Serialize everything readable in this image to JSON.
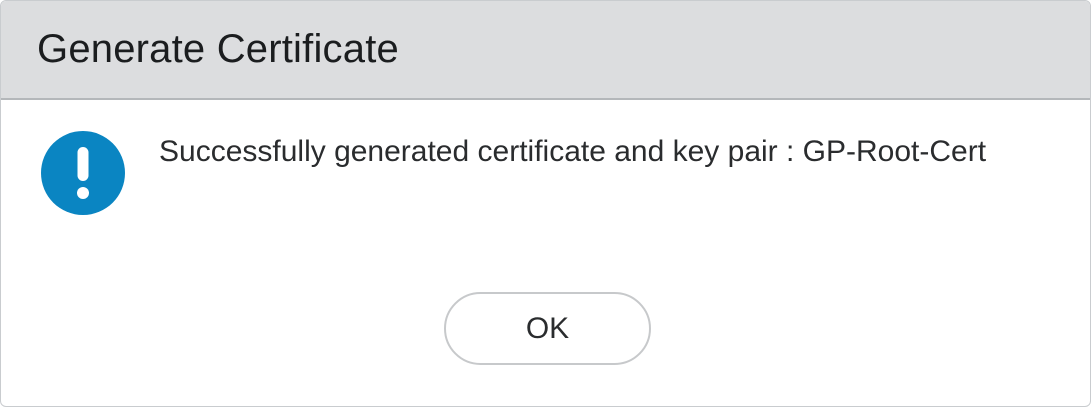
{
  "dialog": {
    "title": "Generate Certificate",
    "icon": "info-exclamation-icon",
    "message": "Successfully generated certificate and key pair : GP-Root-Cert",
    "ok_label": "OK"
  },
  "colors": {
    "header_background": "#dcdddf",
    "icon_blue": "#0a85c2",
    "text": "#2a2c2e"
  }
}
